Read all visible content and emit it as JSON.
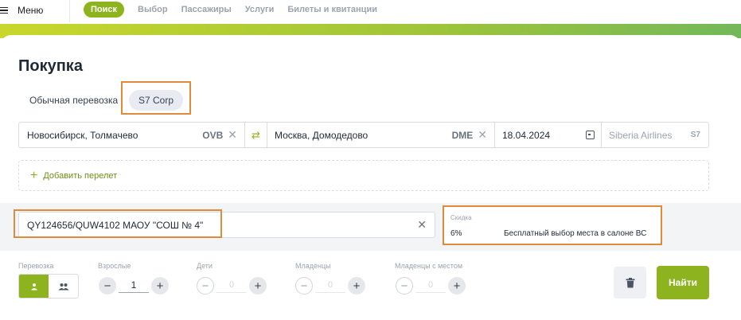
{
  "nav": {
    "menu_label": "Меню",
    "tabs": [
      "Поиск",
      "Выбор",
      "Пассажиры",
      "Услуги",
      "Билеты и квитанции"
    ]
  },
  "page": {
    "title": "Покупка"
  },
  "purchase_types": {
    "normal": "Обычная перевозка",
    "corp": "S7 Corp",
    "selected": "S7 Corp"
  },
  "route": {
    "from_city": "Новосибирск, Толмачево",
    "from_code": "OVB",
    "to_city": "Москва, Домодедово",
    "to_code": "DME",
    "date": "18.04.2024",
    "airline": "Siberia Airlines",
    "airline_code": "S7"
  },
  "add_flight_label": "Добавить перелет",
  "corporate_code": "QY124656/QUW4102 МАОУ \"СОШ № 4\"",
  "discount": {
    "label": "Скидка",
    "percent": "6%",
    "description": "Бесплатный выбор места в салоне ВС"
  },
  "passengers": {
    "transport_label": "Перевозка",
    "adults_label": "Взрослые",
    "adults": "1",
    "children_label": "Дети",
    "children": "0",
    "infants_label": "Младенцы",
    "infants": "0",
    "infants_seat_label": "Младенцы с местом",
    "infants_seat": "0"
  },
  "actions": {
    "find_label": "Найти"
  },
  "colors": {
    "accent": "#8db31f",
    "highlight": "#e08a3c"
  },
  "icons": [
    "menu-icon",
    "close-icon",
    "swap-icon",
    "calendar-icon",
    "plus-icon",
    "person-icon",
    "group-icon",
    "trash-icon"
  ]
}
